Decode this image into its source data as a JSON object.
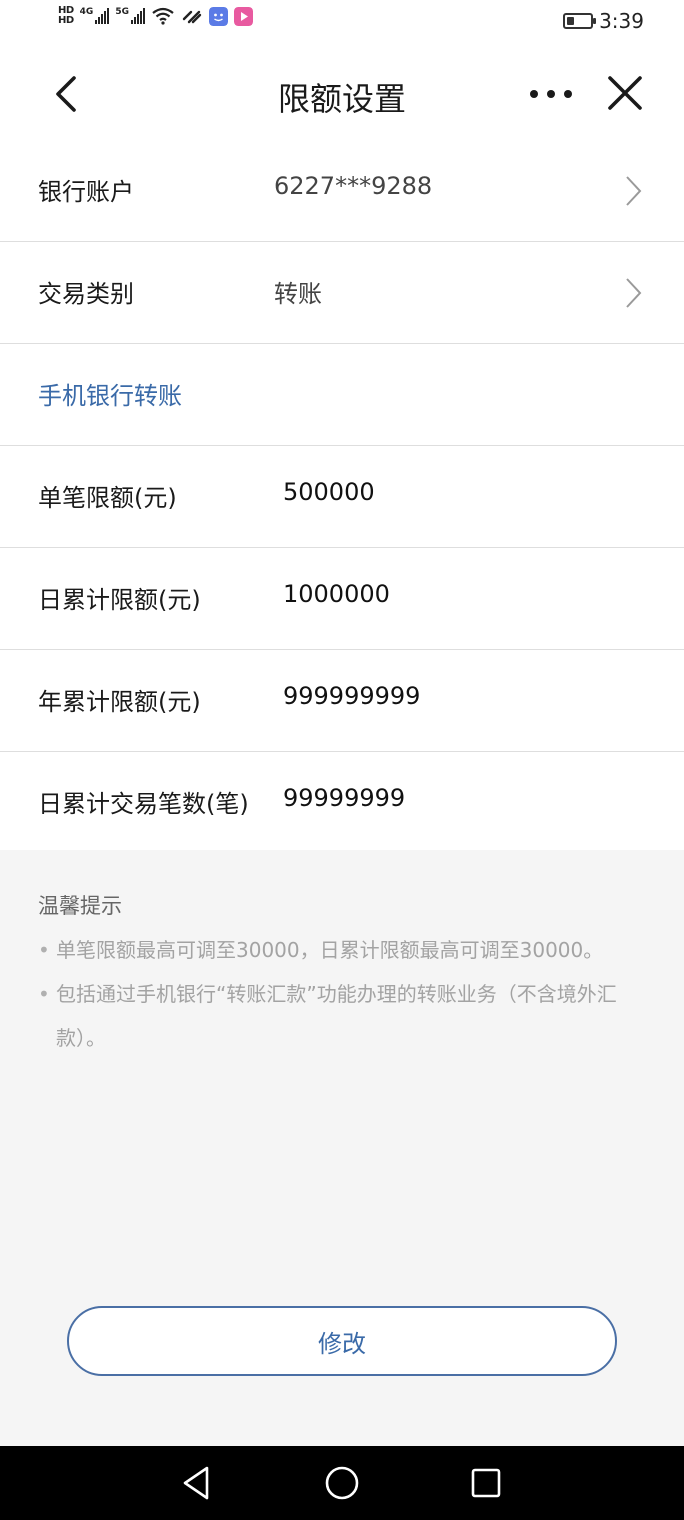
{
  "status_bar": {
    "hd1": "HD",
    "hd2": "HD",
    "net1": "4G",
    "net2": "5G",
    "time": "3:39",
    "battery_level": 0.3
  },
  "header": {
    "title": "限额设置"
  },
  "rows": {
    "account_label": "银行账户",
    "account_value": "6227***9288",
    "type_label": "交易类别",
    "type_value": "转账",
    "section_label": "手机银行转账"
  },
  "limits": [
    {
      "label": "单笔限额(元)",
      "value": "500000"
    },
    {
      "label": "日累计限额(元)",
      "value": "1000000"
    },
    {
      "label": "年累计限额(元)",
      "value": "999999999"
    },
    {
      "label": "日累计交易笔数(笔)",
      "value": "99999999"
    }
  ],
  "tips": {
    "title": "温馨提示",
    "items": [
      "单笔限额最高可调至30000，日累计限额最高可调至30000。",
      "包括通过手机银行“转账汇款”功能办理的转账业务（不含境外汇款）。"
    ]
  },
  "actions": {
    "modify_label": "修改"
  },
  "colors": {
    "accent": "#3a6aa8",
    "tips_bg": "#f5f5f5",
    "divider": "#dedede"
  }
}
